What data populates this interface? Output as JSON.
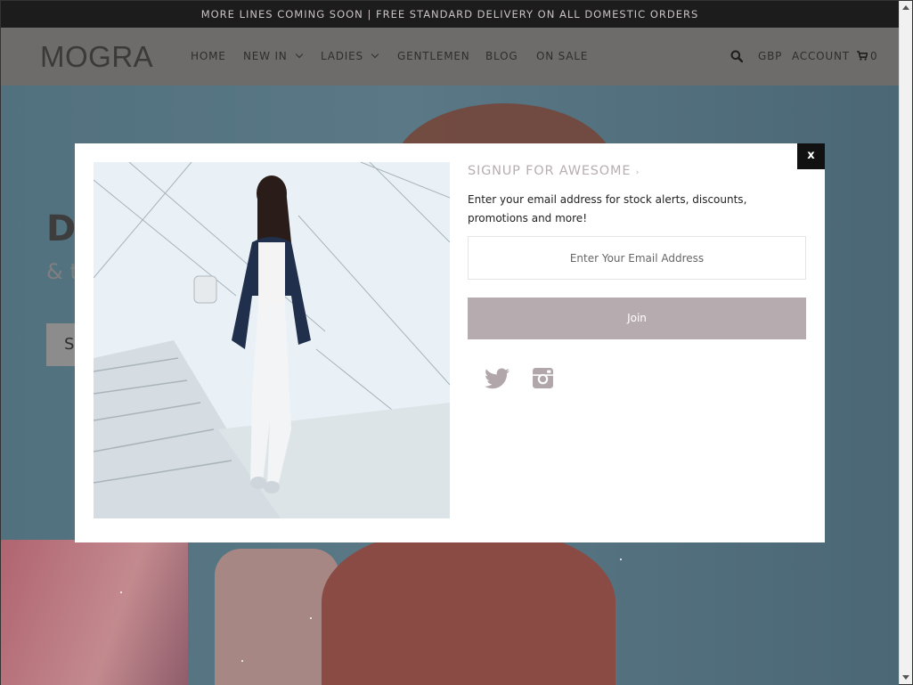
{
  "announcement": "MORE LINES COMING SOON | FREE STANDARD DELIVERY ON ALL DOMESTIC ORDERS",
  "header": {
    "logo": "MOGRA",
    "nav": [
      {
        "label": "HOME"
      },
      {
        "label": "NEW IN"
      },
      {
        "label": "LADIES"
      },
      {
        "label": "GENTLEMEN"
      },
      {
        "label": "BLOG"
      },
      {
        "label": "ON SALE"
      }
    ],
    "currency": "GBP",
    "account": "ACCOUNT",
    "cart_count": "0",
    "icons": {
      "search": "search-icon",
      "cart": "cart-icon"
    }
  },
  "hero": {
    "headline_fragment": "D",
    "sub_fragment": "& t",
    "button_fragment": "S"
  },
  "modal": {
    "close_label": "x",
    "title": "SIGNUP FOR AWESOME",
    "description": "Enter your email address for stock alerts, discounts, promotions and more!",
    "email_placeholder": "Enter Your Email Address",
    "join_label": "Join",
    "social_icons": [
      "twitter-icon",
      "instagram-icon"
    ]
  },
  "colors": {
    "accent": "#b6acaf",
    "announce_bg": "#1c1c1c",
    "header_bg": "#6e6c6a",
    "close_bg": "#111111"
  }
}
